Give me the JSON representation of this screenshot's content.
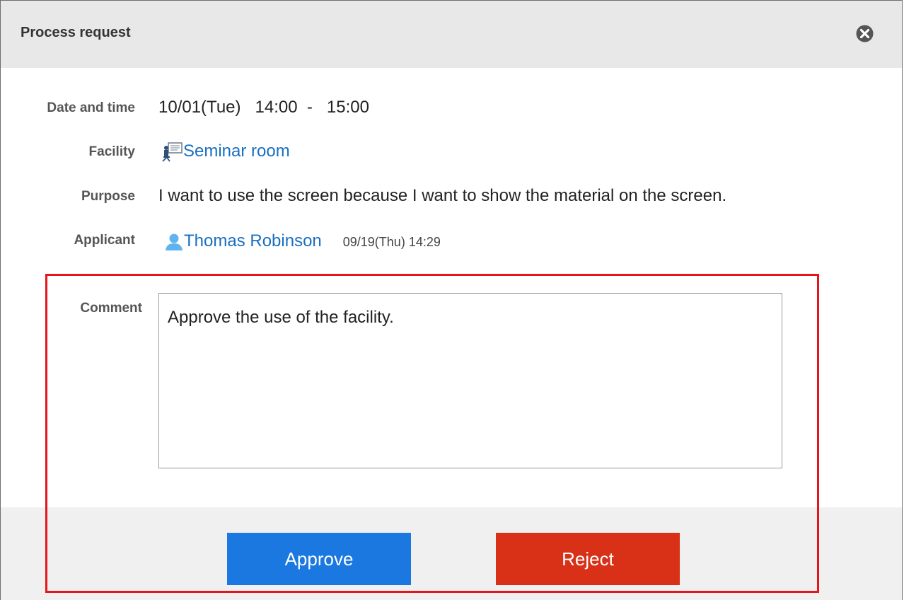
{
  "dialog": {
    "title": "Process request",
    "close_icon": "close-circle-icon"
  },
  "details": {
    "date_label": "Date and time",
    "date_value": "10/01(Tue)   14:00  -   15:00",
    "facility_label": "Facility",
    "facility_icon": "facility-icon",
    "facility_value": "Seminar room",
    "purpose_label": "Purpose",
    "purpose_value": "I want to use the screen because I want to show the material on the screen.",
    "applicant_label": "Applicant",
    "applicant_icon": "user-icon",
    "applicant_name": "Thomas Robinson",
    "applicant_date": "09/19(Thu) 14:29"
  },
  "comment": {
    "label": "Comment",
    "value": "Approve the use of the facility."
  },
  "actions": {
    "approve_label": "Approve",
    "reject_label": "Reject",
    "approve_color": "#1a78e0",
    "reject_color": "#d93018"
  },
  "colors": {
    "link": "#1a6fc0",
    "highlight": "#e8141c",
    "titlebar": "#e8e8e8"
  }
}
